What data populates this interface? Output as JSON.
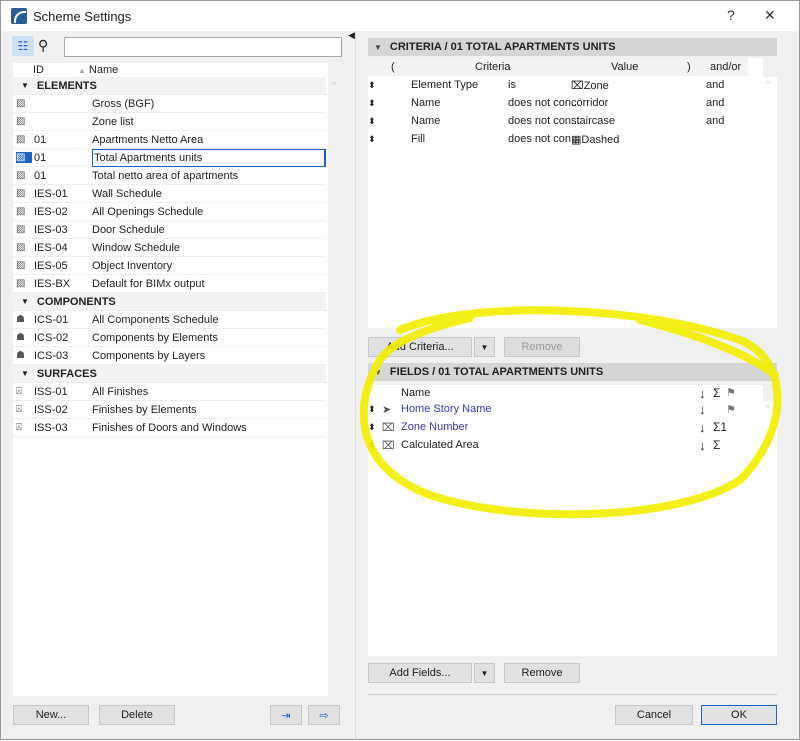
{
  "window": {
    "title": "Scheme Settings",
    "help": "?",
    "close": "✕"
  },
  "left": {
    "search_placeholder": "",
    "columns": {
      "id": "ID",
      "name": "Name"
    },
    "groups": [
      {
        "label": "ELEMENTS",
        "icon": "fill-hatch-icon",
        "items": [
          {
            "id": "",
            "name": "Gross (BGF)"
          },
          {
            "id": "",
            "name": "Zone list"
          },
          {
            "id": "01",
            "name": "Apartments Netto Area"
          },
          {
            "id": "01",
            "name": "Total Apartments units",
            "selected": true
          },
          {
            "id": "01",
            "name": "Total netto area of apartments"
          },
          {
            "id": "IES-01",
            "name": "Wall Schedule"
          },
          {
            "id": "IES-02",
            "name": "All Openings Schedule"
          },
          {
            "id": "IES-03",
            "name": "Door Schedule"
          },
          {
            "id": "IES-04",
            "name": "Window Schedule"
          },
          {
            "id": "IES-05",
            "name": "Object Inventory"
          },
          {
            "id": "IES-BX",
            "name": "Default for BIMx output"
          }
        ]
      },
      {
        "label": "COMPONENTS",
        "icon": "components-icon",
        "items": [
          {
            "id": "ICS-01",
            "name": "All Components Schedule"
          },
          {
            "id": "ICS-02",
            "name": "Components by Elements"
          },
          {
            "id": "ICS-03",
            "name": "Components by Layers"
          }
        ]
      },
      {
        "label": "SURFACES",
        "icon": "paint-brush-icon",
        "items": [
          {
            "id": "ISS-01",
            "name": "All Finishes"
          },
          {
            "id": "ISS-02",
            "name": "Finishes by Elements"
          },
          {
            "id": "ISS-03",
            "name": "Finishes of Doors and Windows"
          }
        ]
      }
    ],
    "new_label": "New...",
    "delete_label": "Delete"
  },
  "criteria": {
    "title": "CRITERIA / 01 TOTAL APARTMENTS UNITS",
    "columns": {
      "open": "(",
      "criteria": "Criteria",
      "value": "Value",
      "close": ")",
      "andor": "and/or"
    },
    "rows": [
      {
        "field": "Element Type",
        "op": "is",
        "value": "Zone",
        "value_icon": "zone-icon",
        "andor": "and"
      },
      {
        "field": "Name",
        "op": "does not con...",
        "value": "corridor",
        "andor": "and"
      },
      {
        "field": "Name",
        "op": "does not con...",
        "value": "staircase",
        "andor": "and"
      },
      {
        "field": "Fill",
        "op": "does not con...",
        "value": "Dashed",
        "value_icon": "fill-swatch-icon",
        "andor": ""
      }
    ],
    "add_label": "Add Criteria...",
    "remove_label": "Remove"
  },
  "fields": {
    "title": "FIELDS / 01 TOTAL APARTMENTS UNITS",
    "columns": {
      "name": "Name",
      "sort": "↓",
      "sum": "Σ",
      "flag": "⚑"
    },
    "rows": [
      {
        "icon": "cursor-icon",
        "name": "Home Story Name",
        "sort": "↓",
        "sum": "",
        "flag": "⚑",
        "highlight": true
      },
      {
        "icon": "zone-icon",
        "name": "Zone Number",
        "sort": "↓",
        "sum": "Σ1",
        "flag": "",
        "highlight": true
      },
      {
        "icon": "zone-icon",
        "name": "Calculated Area",
        "sort": "↓",
        "sum": "Σ",
        "flag": "",
        "highlight": false
      }
    ],
    "add_label": "Add Fields...",
    "remove_label": "Remove"
  },
  "footer": {
    "cancel": "Cancel",
    "ok": "OK"
  },
  "colors": {
    "selection": "#1a63c5",
    "highlight_text": "#3a3ab0",
    "annotation": "#f2ee00"
  }
}
